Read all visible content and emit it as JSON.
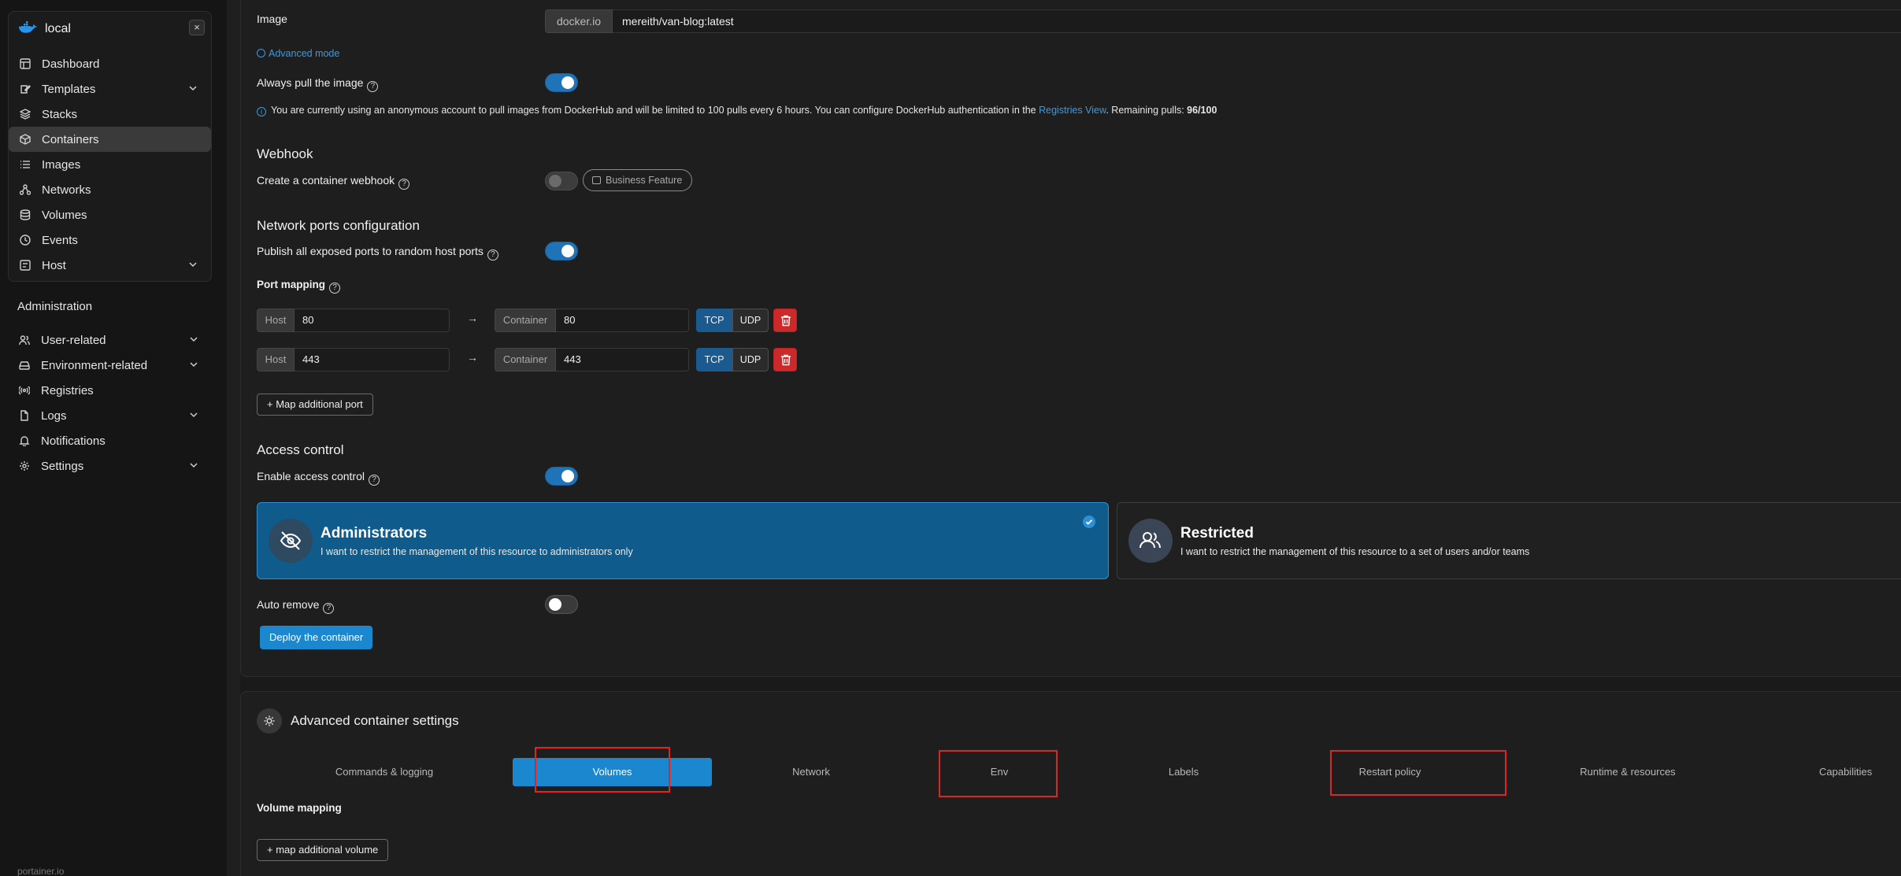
{
  "sidebar": {
    "env_name": "local",
    "close_glyph": "×",
    "items": [
      {
        "label": "Dashboard",
        "icon": "dashboard-icon"
      },
      {
        "label": "Templates",
        "icon": "templates-icon"
      },
      {
        "label": "Stacks",
        "icon": "stacks-icon"
      },
      {
        "label": "Containers",
        "icon": "containers-icon"
      },
      {
        "label": "Images",
        "icon": "images-icon"
      },
      {
        "label": "Networks",
        "icon": "networks-icon"
      },
      {
        "label": "Volumes",
        "icon": "volumes-icon"
      },
      {
        "label": "Events",
        "icon": "events-icon"
      },
      {
        "label": "Host",
        "icon": "host-icon"
      }
    ],
    "admin_title": "Administration",
    "admin_items": [
      {
        "label": "User-related",
        "icon": "users-icon"
      },
      {
        "label": "Environment-related",
        "icon": "environment-icon"
      },
      {
        "label": "Registries",
        "icon": "registries-icon"
      },
      {
        "label": "Logs",
        "icon": "logs-icon"
      },
      {
        "label": "Notifications",
        "icon": "bell-icon"
      },
      {
        "label": "Settings",
        "icon": "gear-icon"
      }
    ],
    "footer": "portainer.io"
  },
  "form": {
    "image_label": "Image",
    "image_registry": "docker.io",
    "image_value": "mereith/van-blog:latest",
    "advanced_mode": "Advanced mode",
    "always_pull_label": "Always pull the image",
    "info_text_1": "You are currently using an anonymous account to pull images from DockerHub and will be limited to 100 pulls every 6 hours. You can configure DockerHub authentication in the ",
    "info_link": "Registries View",
    "info_text_2": ". Remaining pulls: ",
    "info_pulls": "96/100",
    "webhook_title": "Webhook",
    "webhook_label": "Create a container webhook",
    "business_badge": "Business Feature",
    "network_title": "Network ports configuration",
    "publish_label": "Publish all exposed ports to random host ports",
    "port_mapping_label": "Port mapping",
    "host_prefix": "Host",
    "container_prefix": "Container",
    "ports": [
      {
        "host": "80",
        "container": "80",
        "tcp": "TCP",
        "udp": "UDP"
      },
      {
        "host": "443",
        "container": "443",
        "tcp": "TCP",
        "udp": "UDP"
      }
    ],
    "map_port_btn": "+ Map additional port",
    "access_title": "Access control",
    "access_label": "Enable access control",
    "admin_card_title": "Administrators",
    "admin_card_desc": "I want to restrict the management of this resource to administrators only",
    "restricted_card_title": "Restricted",
    "restricted_card_desc": "I want to restrict the management of this resource to a set of users and/or teams",
    "auto_remove_label": "Auto remove",
    "deploy_btn": "Deploy the container",
    "help_glyph": "?",
    "arrow_glyph": "→"
  },
  "advanced": {
    "title": "Advanced container settings",
    "tabs": [
      "Commands & logging",
      "Volumes",
      "Network",
      "Env",
      "Labels",
      "Restart policy",
      "Runtime & resources",
      "Capabilities"
    ],
    "active_tab": "Volumes",
    "volume_title": "Volume mapping",
    "map_volume_btn": "+ map additional volume"
  },
  "colors": {
    "accent": "#1a87cf",
    "danger": "#cc2a2a",
    "highlight_box": "#e02424"
  }
}
